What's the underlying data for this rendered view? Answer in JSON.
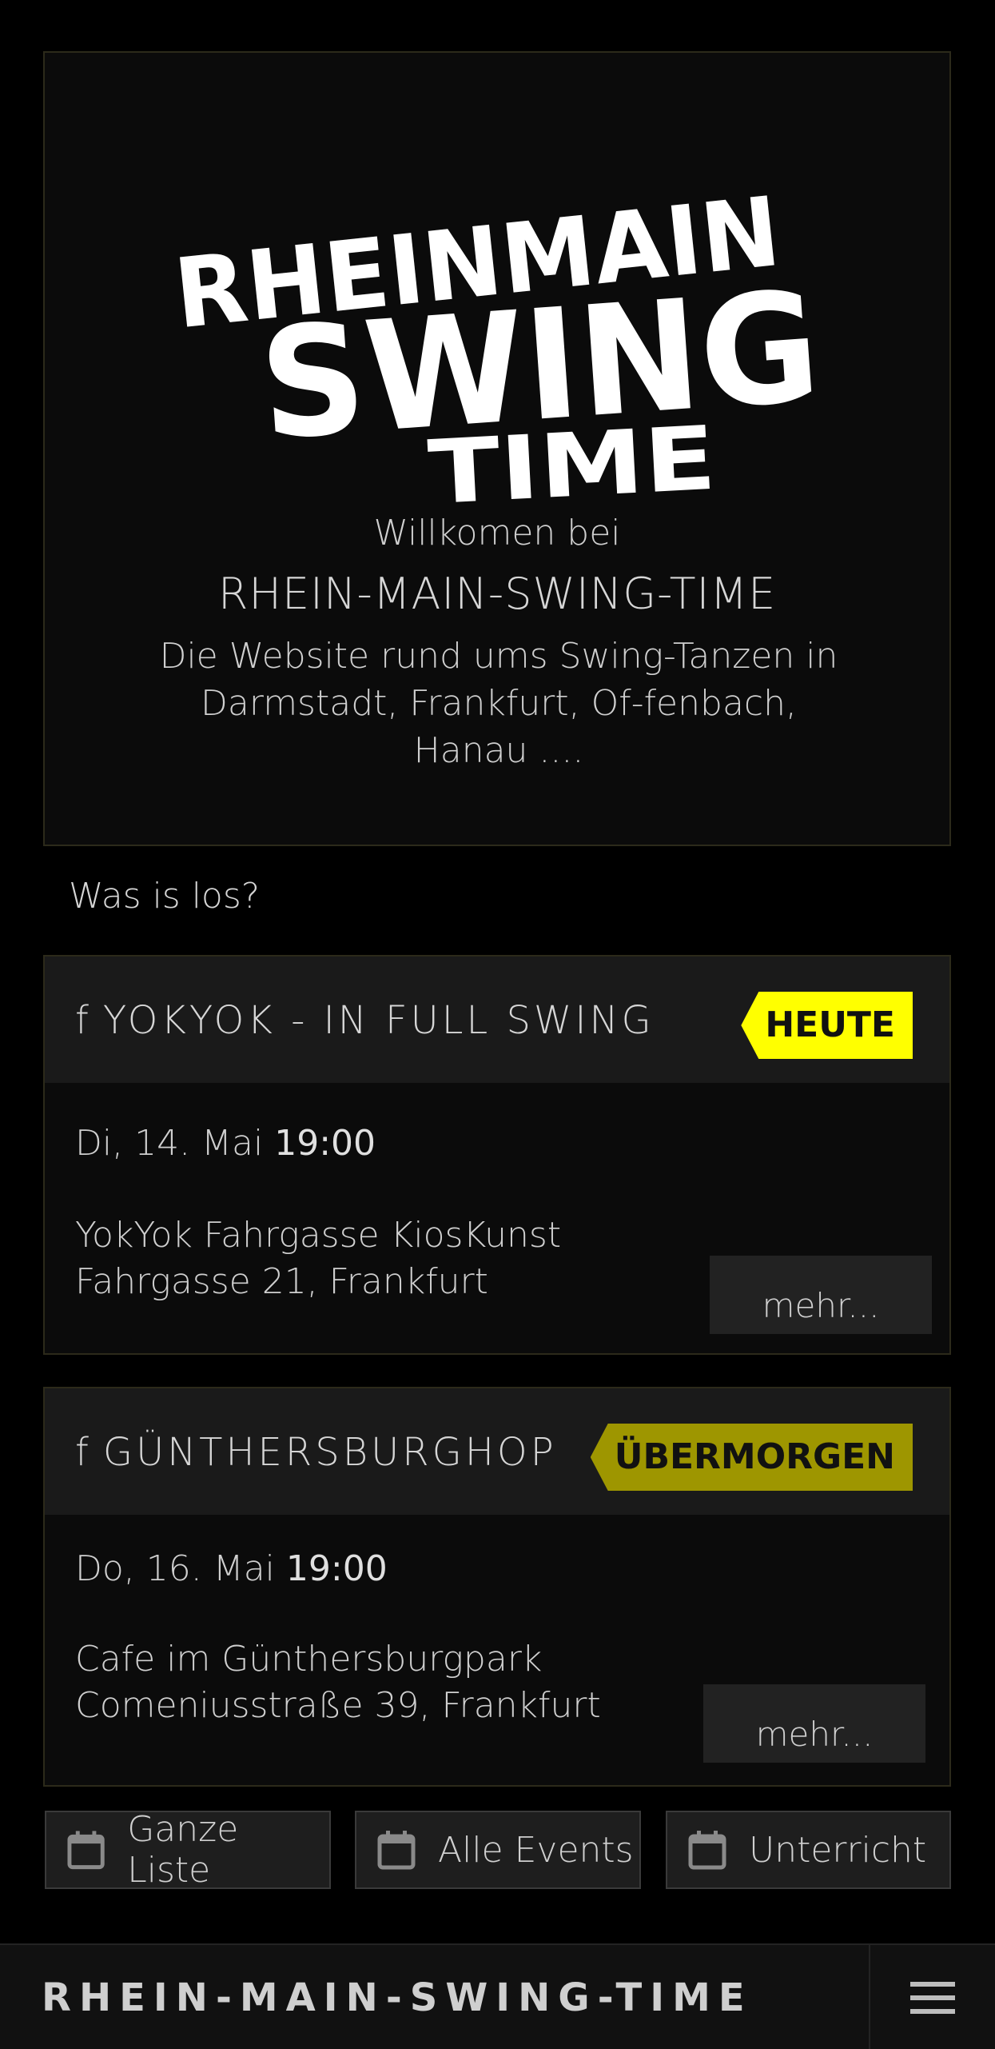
{
  "hero": {
    "logo_text": "RHEINMAIN SWING TIME",
    "welcome": "Willkomen bei",
    "title": "RHEIN-MAIN-SWING-TIME",
    "tagline": "Die Website rund ums Swing-Tanzen in Darmstadt, Frankfurt, Of-fenbach, Hanau ...."
  },
  "section_label": "Was is los?",
  "events": [
    {
      "icon": "facebook-icon",
      "fb": "f",
      "title": "YOKYOK - IN FULL SWING",
      "badge": "HEUTE",
      "badge_color": "#ffff00",
      "date": "Di, 14. Mai",
      "time": "19:00",
      "venue": "YokYok Fahrgasse KiosKunst",
      "address": "Fahrgasse 21, Frankfurt",
      "more": "mehr..."
    },
    {
      "icon": "facebook-icon",
      "fb": "f",
      "title": "GÜNTHERSBURGHOP",
      "badge": "ÜBERMORGEN",
      "badge_color": "#9e9600",
      "date": "Do, 16. Mai",
      "time": "19:00",
      "venue": "Cafe im Günthersburgpark",
      "address": "Comeniusstraße 39, Frankfurt",
      "more": "mehr..."
    }
  ],
  "nav_buttons": [
    {
      "icon": "calendar-icon",
      "label": "Ganze Liste"
    },
    {
      "icon": "calendar-icon",
      "label": "Alle Events"
    },
    {
      "icon": "calendar-icon",
      "label": "Unterricht"
    }
  ],
  "bottom_bar": {
    "brand": "RHEIN-MAIN-SWING-TIME",
    "menu_icon": "hamburger-menu-icon"
  }
}
